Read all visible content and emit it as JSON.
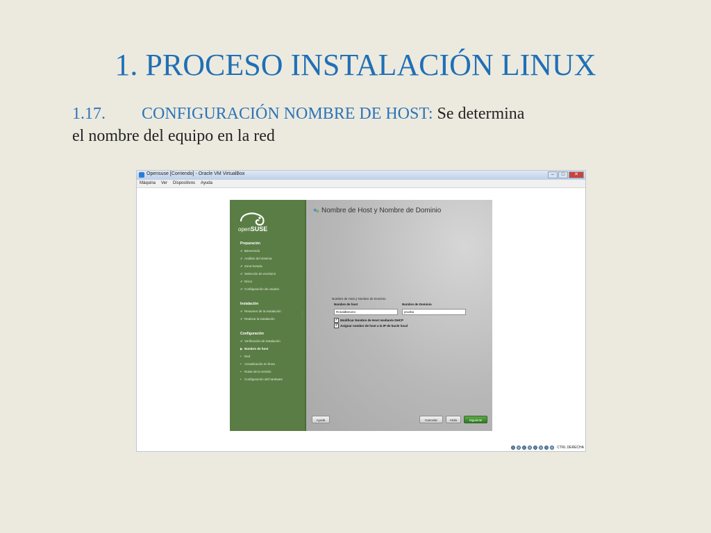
{
  "slide": {
    "title": "1. PROCESO INSTALACIÓN LINUX",
    "subtitle_number": "1.17.",
    "subtitle_heading": "CONFIGURACIÓN NOMBRE DE HOST:",
    "subtitle_text_1": "Se determina",
    "subtitle_text_2": "el nombre del equipo en la red"
  },
  "vm_window": {
    "title": "Opensuse [Corriendo] - Oracle VM VirtualBox",
    "menu": [
      "Máquina",
      "Ver",
      "Dispositivos",
      "Ayuda"
    ],
    "status_text": "CTRL DERECHA"
  },
  "installer": {
    "logo_text": "openSUSE",
    "sections": [
      {
        "label": "Preparación",
        "items": [
          {
            "label": "Bienvenido",
            "state": "done"
          },
          {
            "label": "Análisis del sistema",
            "state": "done"
          },
          {
            "label": "Zona horaria",
            "state": "done"
          },
          {
            "label": "Selección de escritorio",
            "state": "done"
          },
          {
            "label": "Disco",
            "state": "done"
          },
          {
            "label": "Configuración de usuario",
            "state": "done"
          }
        ]
      },
      {
        "label": "Instalación",
        "items": [
          {
            "label": "Resumen de la instalación",
            "state": "done"
          },
          {
            "label": "Realizar la instalación",
            "state": "done"
          }
        ]
      },
      {
        "label": "Configuración",
        "items": [
          {
            "label": "Verificación de instalación",
            "state": "done"
          },
          {
            "label": "Nombre de host",
            "state": "current"
          },
          {
            "label": "Red",
            "state": "pending"
          },
          {
            "label": "Actualización en línea",
            "state": "pending"
          },
          {
            "label": "Notas de la versión",
            "state": "pending"
          },
          {
            "label": "Configuración del hardware",
            "state": "pending"
          }
        ]
      }
    ],
    "page_title": "Nombre de Host y Nombre de Dominio",
    "group_label": "Nombre de Host y Nombre de Dominio",
    "hostname_label": "Nombre de host",
    "hostname_value": "Ronaldtenorio",
    "domain_label": "Nombre de Dominio",
    "domain_value": "prueba",
    "checkbox_dhcp": "Modificar Nombre de Host mediante DHCP",
    "checkbox_loopback": "Asignar nombre de host a la IP de bucle local",
    "help_button": "Ayuda",
    "cancel_button": "Cancelar",
    "back_button": "Atrás",
    "next_button": "Siguiente"
  },
  "colors": {
    "title": "#1F6FB5",
    "sidebar": "#5a7d45",
    "next_button": "#2f7a23"
  }
}
